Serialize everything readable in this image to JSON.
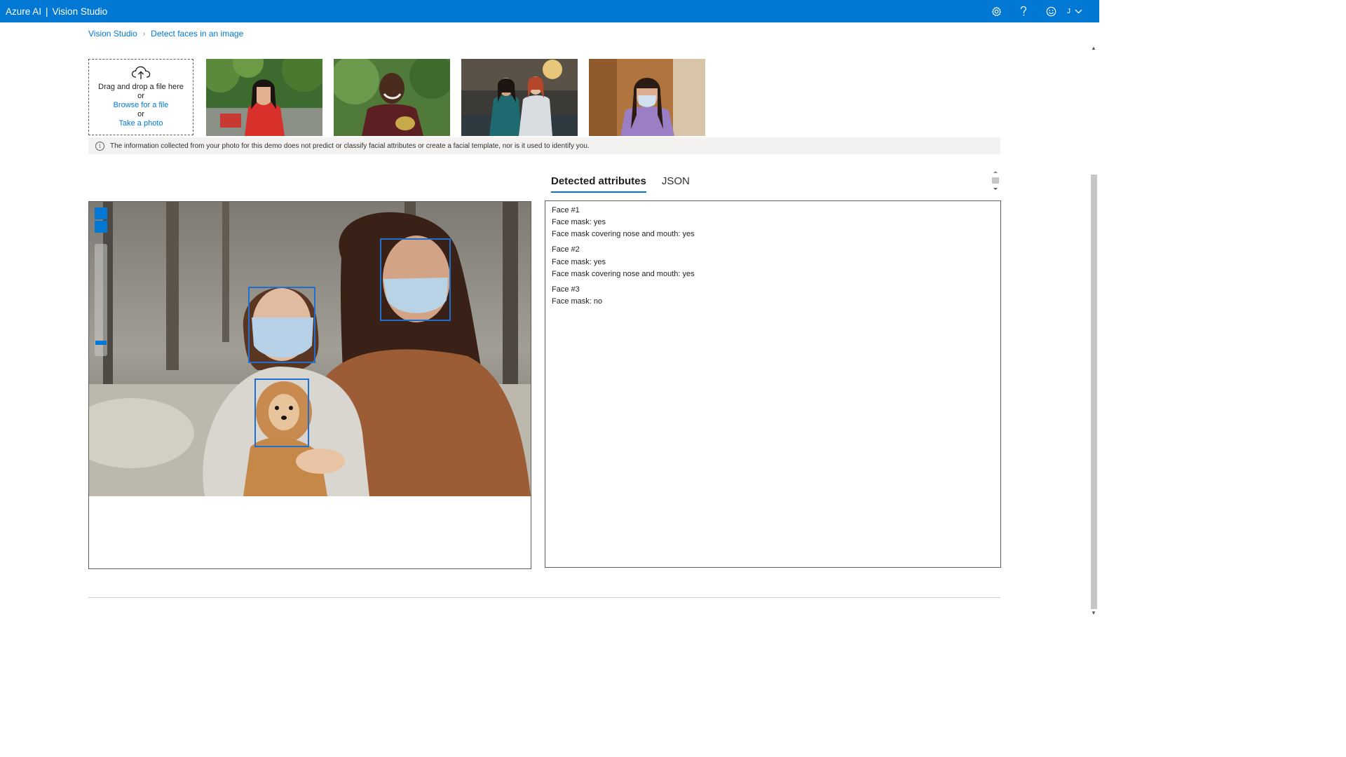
{
  "app": {
    "brand_left": "Azure AI",
    "brand_sep": "|",
    "brand_right": "Vision Studio",
    "account_initial": "J"
  },
  "topbar_icons": [
    "settings-gear-icon",
    "help-question-icon",
    "feedback-smiley-icon"
  ],
  "breadcrumb": {
    "root": "Vision Studio",
    "current": "Detect faces in an image"
  },
  "upload": {
    "drag_text": "Drag and drop a file here",
    "or_1": "or",
    "browse_label": "Browse for a file",
    "or_2": "or",
    "photo_label": "Take a photo"
  },
  "info_banner": {
    "text": "The information collected from your photo for this demo does not predict or classify facial attributes or create a facial template, nor is it used to identify you."
  },
  "tabs": [
    {
      "label": "Detected attributes",
      "active": true
    },
    {
      "label": "JSON",
      "active": false
    }
  ],
  "faces": [
    {
      "title": "Face #1",
      "lines": [
        "Face mask: yes",
        "Face mask covering nose and mouth: yes"
      ]
    },
    {
      "title": "Face #2",
      "lines": [
        "Face mask: yes",
        "Face mask covering nose and mouth: yes"
      ]
    },
    {
      "title": "Face #3",
      "lines": [
        "Face mask: no"
      ]
    }
  ],
  "colors": {
    "accent": "#0078d4",
    "face_box": "#1e6fd0"
  }
}
